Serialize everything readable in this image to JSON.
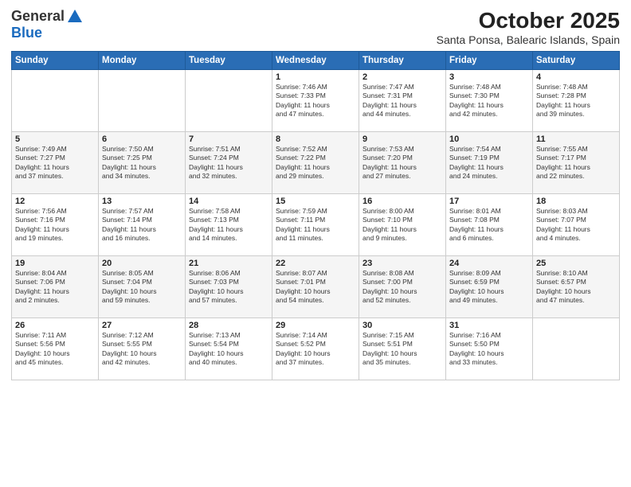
{
  "logo": {
    "general": "General",
    "blue": "Blue"
  },
  "title": "October 2025",
  "location": "Santa Ponsa, Balearic Islands, Spain",
  "days_of_week": [
    "Sunday",
    "Monday",
    "Tuesday",
    "Wednesday",
    "Thursday",
    "Friday",
    "Saturday"
  ],
  "weeks": [
    [
      {
        "day": "",
        "info": ""
      },
      {
        "day": "",
        "info": ""
      },
      {
        "day": "",
        "info": ""
      },
      {
        "day": "1",
        "info": "Sunrise: 7:46 AM\nSunset: 7:33 PM\nDaylight: 11 hours\nand 47 minutes."
      },
      {
        "day": "2",
        "info": "Sunrise: 7:47 AM\nSunset: 7:31 PM\nDaylight: 11 hours\nand 44 minutes."
      },
      {
        "day": "3",
        "info": "Sunrise: 7:48 AM\nSunset: 7:30 PM\nDaylight: 11 hours\nand 42 minutes."
      },
      {
        "day": "4",
        "info": "Sunrise: 7:48 AM\nSunset: 7:28 PM\nDaylight: 11 hours\nand 39 minutes."
      }
    ],
    [
      {
        "day": "5",
        "info": "Sunrise: 7:49 AM\nSunset: 7:27 PM\nDaylight: 11 hours\nand 37 minutes."
      },
      {
        "day": "6",
        "info": "Sunrise: 7:50 AM\nSunset: 7:25 PM\nDaylight: 11 hours\nand 34 minutes."
      },
      {
        "day": "7",
        "info": "Sunrise: 7:51 AM\nSunset: 7:24 PM\nDaylight: 11 hours\nand 32 minutes."
      },
      {
        "day": "8",
        "info": "Sunrise: 7:52 AM\nSunset: 7:22 PM\nDaylight: 11 hours\nand 29 minutes."
      },
      {
        "day": "9",
        "info": "Sunrise: 7:53 AM\nSunset: 7:20 PM\nDaylight: 11 hours\nand 27 minutes."
      },
      {
        "day": "10",
        "info": "Sunrise: 7:54 AM\nSunset: 7:19 PM\nDaylight: 11 hours\nand 24 minutes."
      },
      {
        "day": "11",
        "info": "Sunrise: 7:55 AM\nSunset: 7:17 PM\nDaylight: 11 hours\nand 22 minutes."
      }
    ],
    [
      {
        "day": "12",
        "info": "Sunrise: 7:56 AM\nSunset: 7:16 PM\nDaylight: 11 hours\nand 19 minutes."
      },
      {
        "day": "13",
        "info": "Sunrise: 7:57 AM\nSunset: 7:14 PM\nDaylight: 11 hours\nand 16 minutes."
      },
      {
        "day": "14",
        "info": "Sunrise: 7:58 AM\nSunset: 7:13 PM\nDaylight: 11 hours\nand 14 minutes."
      },
      {
        "day": "15",
        "info": "Sunrise: 7:59 AM\nSunset: 7:11 PM\nDaylight: 11 hours\nand 11 minutes."
      },
      {
        "day": "16",
        "info": "Sunrise: 8:00 AM\nSunset: 7:10 PM\nDaylight: 11 hours\nand 9 minutes."
      },
      {
        "day": "17",
        "info": "Sunrise: 8:01 AM\nSunset: 7:08 PM\nDaylight: 11 hours\nand 6 minutes."
      },
      {
        "day": "18",
        "info": "Sunrise: 8:03 AM\nSunset: 7:07 PM\nDaylight: 11 hours\nand 4 minutes."
      }
    ],
    [
      {
        "day": "19",
        "info": "Sunrise: 8:04 AM\nSunset: 7:06 PM\nDaylight: 11 hours\nand 2 minutes."
      },
      {
        "day": "20",
        "info": "Sunrise: 8:05 AM\nSunset: 7:04 PM\nDaylight: 10 hours\nand 59 minutes."
      },
      {
        "day": "21",
        "info": "Sunrise: 8:06 AM\nSunset: 7:03 PM\nDaylight: 10 hours\nand 57 minutes."
      },
      {
        "day": "22",
        "info": "Sunrise: 8:07 AM\nSunset: 7:01 PM\nDaylight: 10 hours\nand 54 minutes."
      },
      {
        "day": "23",
        "info": "Sunrise: 8:08 AM\nSunset: 7:00 PM\nDaylight: 10 hours\nand 52 minutes."
      },
      {
        "day": "24",
        "info": "Sunrise: 8:09 AM\nSunset: 6:59 PM\nDaylight: 10 hours\nand 49 minutes."
      },
      {
        "day": "25",
        "info": "Sunrise: 8:10 AM\nSunset: 6:57 PM\nDaylight: 10 hours\nand 47 minutes."
      }
    ],
    [
      {
        "day": "26",
        "info": "Sunrise: 7:11 AM\nSunset: 5:56 PM\nDaylight: 10 hours\nand 45 minutes."
      },
      {
        "day": "27",
        "info": "Sunrise: 7:12 AM\nSunset: 5:55 PM\nDaylight: 10 hours\nand 42 minutes."
      },
      {
        "day": "28",
        "info": "Sunrise: 7:13 AM\nSunset: 5:54 PM\nDaylight: 10 hours\nand 40 minutes."
      },
      {
        "day": "29",
        "info": "Sunrise: 7:14 AM\nSunset: 5:52 PM\nDaylight: 10 hours\nand 37 minutes."
      },
      {
        "day": "30",
        "info": "Sunrise: 7:15 AM\nSunset: 5:51 PM\nDaylight: 10 hours\nand 35 minutes."
      },
      {
        "day": "31",
        "info": "Sunrise: 7:16 AM\nSunset: 5:50 PM\nDaylight: 10 hours\nand 33 minutes."
      },
      {
        "day": "",
        "info": ""
      }
    ]
  ]
}
